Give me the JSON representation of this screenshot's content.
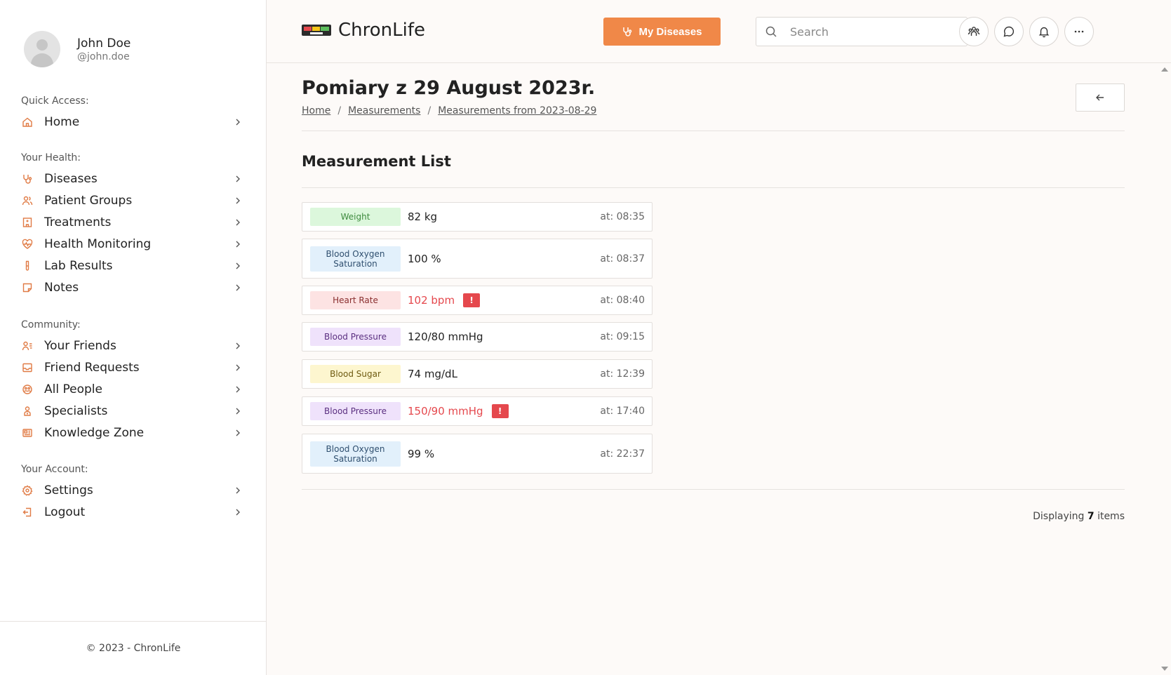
{
  "profile": {
    "name": "John Doe",
    "handle": "@john.doe"
  },
  "sidebar": {
    "sections": [
      {
        "label": "Quick Access:",
        "items": [
          {
            "label": "Home",
            "icon": "home-icon"
          }
        ]
      },
      {
        "label": "Your Health:",
        "items": [
          {
            "label": "Diseases",
            "icon": "stethoscope-icon"
          },
          {
            "label": "Patient Groups",
            "icon": "users-icon"
          },
          {
            "label": "Treatments",
            "icon": "hospital-icon"
          },
          {
            "label": "Health Monitoring",
            "icon": "heart-pulse-icon"
          },
          {
            "label": "Lab Results",
            "icon": "test-tube-icon"
          },
          {
            "label": "Notes",
            "icon": "sticky-note-icon"
          }
        ]
      },
      {
        "label": "Community:",
        "items": [
          {
            "label": "Your Friends",
            "icon": "user-list-icon"
          },
          {
            "label": "Friend Requests",
            "icon": "inbox-icon"
          },
          {
            "label": "All People",
            "icon": "globe-people-icon"
          },
          {
            "label": "Specialists",
            "icon": "specialist-icon"
          },
          {
            "label": "Knowledge Zone",
            "icon": "newspaper-icon"
          }
        ]
      },
      {
        "label": "Your Account:",
        "items": [
          {
            "label": "Settings",
            "icon": "gear-icon"
          },
          {
            "label": "Logout",
            "icon": "logout-icon"
          }
        ]
      }
    ],
    "footer": "© 2023 - ChronLife"
  },
  "header": {
    "logo_text": "ChronLife",
    "my_diseases_label": "My Diseases",
    "search_placeholder": "Search"
  },
  "page": {
    "title": "Pomiary z 29 August 2023r.",
    "breadcrumb": [
      "Home",
      "Measurements",
      "Measurements from 2023-08-29"
    ],
    "section_title": "Measurement List",
    "display_prefix": "Displaying",
    "display_count": "7",
    "display_suffix": "items"
  },
  "measurements": [
    {
      "type": "Weight",
      "value": "82 kg",
      "time": "at: 08:35",
      "alert": false,
      "tag_bg": "#dcf7dc",
      "tag_fg": "#3e8a3e"
    },
    {
      "type": "Blood Oxygen Saturation",
      "value": "100 %",
      "time": "at: 08:37",
      "alert": false,
      "tag_bg": "#e2f0fb",
      "tag_fg": "#2f4f6f"
    },
    {
      "type": "Heart Rate",
      "value": "102 bpm",
      "time": "at: 08:40",
      "alert": true,
      "tag_bg": "#fde3e3",
      "tag_fg": "#8a2f2f"
    },
    {
      "type": "Blood Pressure",
      "value": "120/80 mmHg",
      "time": "at: 09:15",
      "alert": false,
      "tag_bg": "#efe2fb",
      "tag_fg": "#5a2f80"
    },
    {
      "type": "Blood Sugar",
      "value": "74 mg/dL",
      "time": "at: 12:39",
      "alert": false,
      "tag_bg": "#fdf6cf",
      "tag_fg": "#6e5a10"
    },
    {
      "type": "Blood Pressure",
      "value": "150/90 mmHg",
      "time": "at: 17:40",
      "alert": true,
      "tag_bg": "#efe2fb",
      "tag_fg": "#5a2f80"
    },
    {
      "type": "Blood Oxygen Saturation",
      "value": "99 %",
      "time": "at: 22:37",
      "alert": false,
      "tag_bg": "#e2f0fb",
      "tag_fg": "#2f4f6f"
    }
  ],
  "alert_flag": "!",
  "colors": {
    "accent": "#f08848",
    "alert": "#e5484d"
  }
}
